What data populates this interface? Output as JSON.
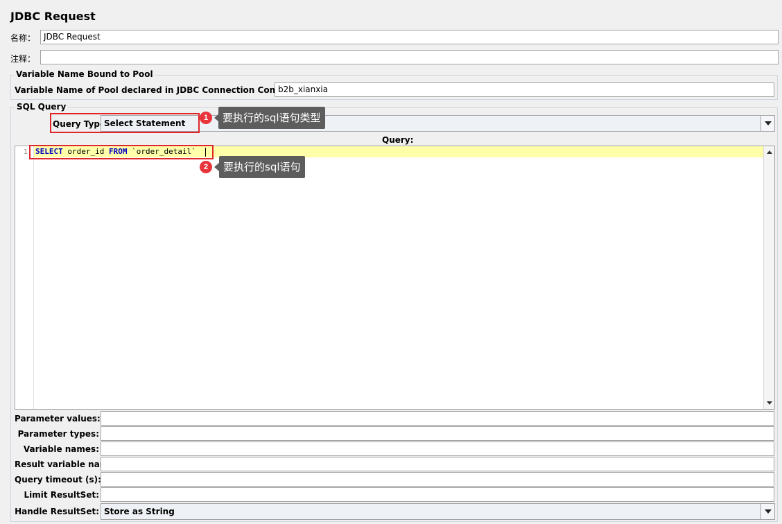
{
  "panel": {
    "title": "JDBC Request"
  },
  "name": {
    "label": "名称：",
    "value": "JDBC Request"
  },
  "comments": {
    "label": "注释：",
    "value": ""
  },
  "pool": {
    "legend": "Variable Name Bound to Pool",
    "label": "Variable Name of Pool declared in JDBC Connection Configuration:",
    "value": "b2b_xianxia"
  },
  "sql": {
    "legend": "SQL Query",
    "query_type_label": "Query Type:",
    "query_type_value": "Select Statement",
    "query_label": "Query:",
    "line_number": "1",
    "code": {
      "kw1": "SELECT",
      "t1": " order_id ",
      "kw2": "FROM",
      "t2": " `order_detail`"
    }
  },
  "params": {
    "parameter_values_label": "Parameter values:",
    "parameter_values": "",
    "parameter_types_label": "Parameter types:",
    "parameter_types": "",
    "variable_names_label": "Variable names:",
    "variable_names": "",
    "result_variable_label": "Result variable name:",
    "result_variable": "",
    "query_timeout_label": "Query timeout (s):",
    "query_timeout": "",
    "limit_resultset_label": "Limit ResultSet:",
    "limit_resultset": "",
    "handle_resultset_label": "Handle ResultSet:",
    "handle_resultset_value": "Store as String"
  },
  "annotations": [
    {
      "number": "1",
      "text": "要执行的sql语句类型"
    },
    {
      "number": "2",
      "text": "要执行的sql语句"
    }
  ]
}
